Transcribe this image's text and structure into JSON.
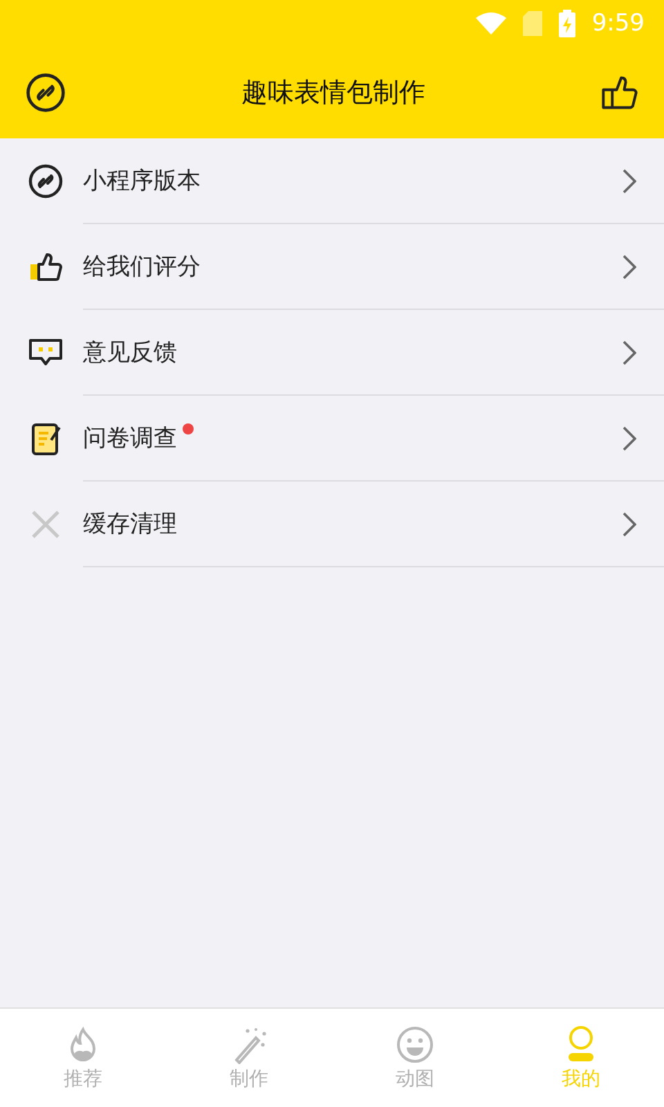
{
  "status_bar": {
    "time": "9:59"
  },
  "header": {
    "title": "趣味表情包制作"
  },
  "menu": [
    {
      "kind": "link",
      "label": "小程序版本",
      "dot": false
    },
    {
      "kind": "thumb",
      "label": "给我们评分",
      "dot": false
    },
    {
      "kind": "feedback",
      "label": "意见反馈",
      "dot": false
    },
    {
      "kind": "survey",
      "label": "问卷调查",
      "dot": true
    },
    {
      "kind": "clear",
      "label": "缓存清理",
      "dot": false
    }
  ],
  "tabs": [
    {
      "kind": "fire",
      "label": "推荐",
      "selected": false
    },
    {
      "kind": "wand",
      "label": "制作",
      "selected": false
    },
    {
      "kind": "smile",
      "label": "动图",
      "selected": false
    },
    {
      "kind": "person",
      "label": "我的",
      "selected": true
    }
  ]
}
